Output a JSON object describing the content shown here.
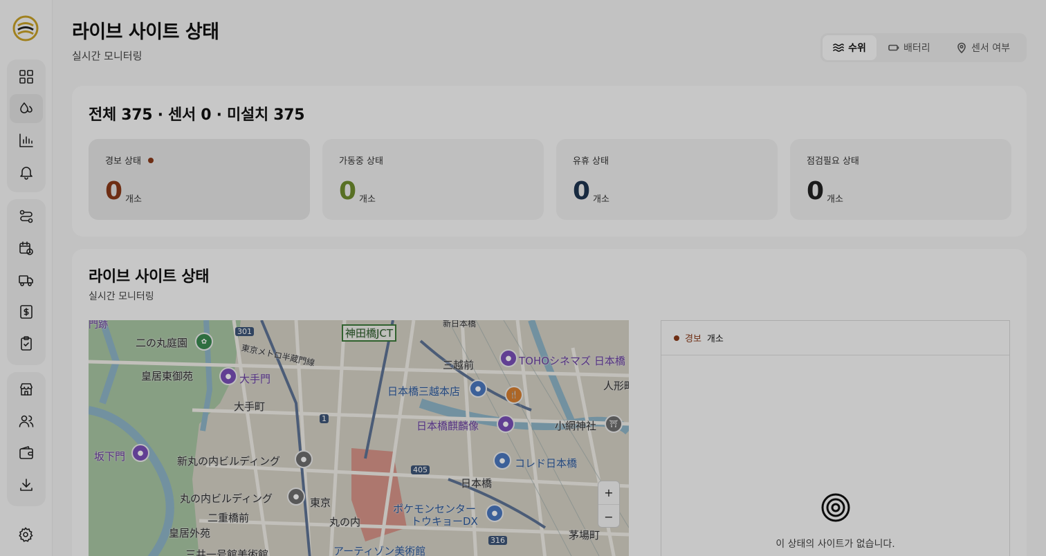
{
  "header": {
    "title": "라이브 사이트 상태",
    "subtitle": "실시간 모니터링"
  },
  "view_toggle": [
    {
      "label": "수위",
      "icon": "water-level-icon",
      "active": true
    },
    {
      "label": "배터리",
      "icon": "battery-icon",
      "active": false
    },
    {
      "label": "센서 여부",
      "icon": "map-pin-icon",
      "active": false
    }
  ],
  "sidebar": {
    "logo": "brand-logo",
    "groups": [
      [
        "dashboard-icon",
        "water-drops-icon",
        "bar-chart-icon",
        "bell-icon"
      ],
      [
        "route-icon",
        "calendar-clock-icon",
        "truck-icon",
        "dollar-receipt-icon",
        "clipboard-check-icon"
      ],
      [
        "store-icon",
        "users-icon",
        "wallet-icon",
        "download-icon"
      ]
    ],
    "active_item": "water-drops-icon",
    "settings_icon": "gear-icon"
  },
  "summary": {
    "title": "전체 375 · 센서 0 · 미설치 375",
    "stats": [
      {
        "label": "경보 상태",
        "value": "0",
        "unit": "개소",
        "color": "#8a3a1a",
        "has_dot": true
      },
      {
        "label": "가동중 상태",
        "value": "0",
        "unit": "개소",
        "color": "#6e8c2e",
        "has_dot": false
      },
      {
        "label": "유휴 상태",
        "value": "0",
        "unit": "개소",
        "color": "#1f3550",
        "has_dot": false
      },
      {
        "label": "점검필요 상태",
        "value": "0",
        "unit": "개소",
        "color": "#222222",
        "has_dot": false
      }
    ]
  },
  "live": {
    "title": "라이브 사이트 상태",
    "subtitle": "실시간 모니터링",
    "map": {
      "labels": {
        "l1": "二の丸庭園",
        "l2": "皇居東御苑",
        "l3": "大手門",
        "l4": "大手町",
        "l5": "坂下門",
        "l6": "新丸の内ビルディング",
        "l7": "丸の内ビルディング",
        "l8": "二重橋前",
        "l9": "皇居外苑",
        "l10": "東京",
        "l11": "丸の内",
        "l12": "三井一号館美術館",
        "l13": "アーティゾン美術館",
        "l14": "神田橋JCT",
        "l15": "三越前",
        "l16": "日本橋三越本店",
        "l17": "日本橋麒麟像",
        "l18": "TOHOシネマズ 日本橋",
        "l19": "コレド日本橋",
        "l20": "日本橋",
        "l21": "ポケモンセンター",
        "l22": "トウキョーDX",
        "l23": "茅場町",
        "l24": "小網神社",
        "l25": "人形町",
        "l26": "東京メトロ半蔵門線",
        "l27": "新日本橋",
        "l28": "門跡"
      },
      "route_shields": [
        "301",
        "405",
        "316",
        "1"
      ],
      "zoom_in": "+",
      "zoom_out": "−"
    },
    "list": {
      "status_label": "경보",
      "unit_label": "개소",
      "dot_color": "#8a3a1a",
      "empty_message": "이 상태의 사이트가 없습니다."
    }
  }
}
